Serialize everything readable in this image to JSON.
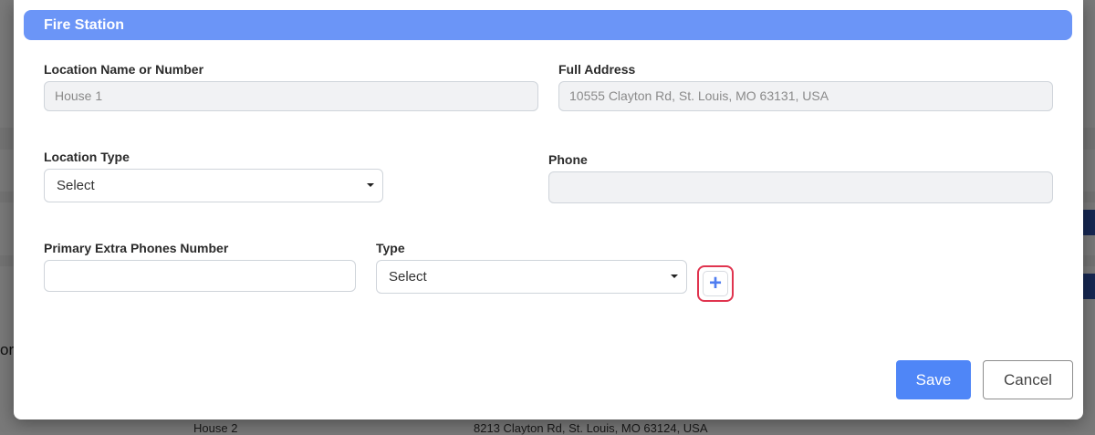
{
  "modal": {
    "title": "Fire Station",
    "fields": {
      "location_name": {
        "label": "Location Name or Number",
        "value": "House 1"
      },
      "full_address": {
        "label": "Full Address",
        "value": "10555 Clayton Rd, St. Louis, MO 63131, USA"
      },
      "location_type": {
        "label": "Location Type",
        "selected": "Select"
      },
      "phone": {
        "label": "Phone",
        "value": ""
      },
      "primary_extra_phone": {
        "label": "Primary Extra Phones Number",
        "value": ""
      },
      "type": {
        "label": "Type",
        "selected": "Select"
      }
    },
    "add_button_symbol": "+",
    "buttons": {
      "save": "Save",
      "cancel": "Cancel"
    }
  },
  "background": {
    "row_location": "House 2",
    "row_address": "8213 Clayton Rd, St. Louis, MO 63124, USA",
    "left_fragment": "or"
  },
  "colors": {
    "header": "#6b95f7",
    "save": "#4f86f7",
    "highlight": "#e0344f"
  }
}
